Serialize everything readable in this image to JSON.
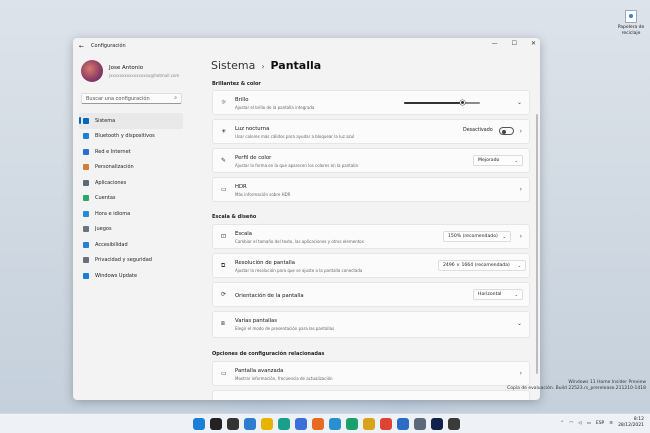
{
  "desktop": {
    "icon_label": "Papelera de reciclaje"
  },
  "window": {
    "title": "Configuración",
    "back_glyph": "←",
    "btn_min": "—",
    "btn_max": "☐",
    "btn_close": "✕"
  },
  "user": {
    "name": "Jose Antonio",
    "email": "jxxxxxxxxxxxxxxxxx@hotmail.com"
  },
  "search": {
    "placeholder": "Buscar una configuración",
    "icon": "search-icon"
  },
  "sidebar": {
    "items": [
      {
        "label": "Sistema",
        "color": "#0067c0",
        "icon": "system-icon",
        "active": true
      },
      {
        "label": "Bluetooth y dispositivos",
        "color": "#1a7fd6",
        "icon": "bluetooth-icon"
      },
      {
        "label": "Red e Internet",
        "color": "#2d6fd1",
        "icon": "network-icon"
      },
      {
        "label": "Personalización",
        "color": "#d27d3b",
        "icon": "brush-icon"
      },
      {
        "label": "Aplicaciones",
        "color": "#5c6b7a",
        "icon": "apps-icon"
      },
      {
        "label": "Cuentas",
        "color": "#2fa566",
        "icon": "account-icon"
      },
      {
        "label": "Hora e idioma",
        "color": "#2b8ad6",
        "icon": "globe-icon"
      },
      {
        "label": "Juegos",
        "color": "#6b7480",
        "icon": "gamepad-icon"
      },
      {
        "label": "Accesibilidad",
        "color": "#2d7dd2",
        "icon": "accessibility-icon"
      },
      {
        "label": "Privacidad y seguridad",
        "color": "#6b6f78",
        "icon": "shield-icon"
      },
      {
        "label": "Windows Update",
        "color": "#1a7fd6",
        "icon": "update-icon"
      }
    ]
  },
  "breadcrumb": {
    "parent": "Sistema",
    "sep": "›",
    "current": "Pantalla"
  },
  "sections": {
    "brightness_color": "Brillantez & color",
    "scale_layout": "Escala & diseño",
    "related": "Opciones de configuración relacionadas"
  },
  "settings": {
    "brillo": {
      "title": "Brillo",
      "subtitle": "Ajustar el brillo de la pantalla integrada",
      "value": 0.77
    },
    "luz": {
      "title": "Luz nocturna",
      "subtitle": "Usar colores más cálidos para ayudar a bloquear la luz azul",
      "state": "Desactivado"
    },
    "perfil": {
      "title": "Perfil de color",
      "subtitle": "Ajustar la forma en la que aparecen los colores en la pantalla",
      "value": "Mejorado"
    },
    "hdr": {
      "title": "HDR",
      "subtitle": "Más información sobre HDR"
    },
    "escala": {
      "title": "Escala",
      "subtitle": "Cambiar el tamaño del texto, las aplicaciones y otros elementos",
      "value": "150% (recomendado)"
    },
    "resolucion": {
      "title": "Resolución de pantalla",
      "subtitle": "Ajustar la resolución para que se ajuste a la pantalla conectada",
      "value": "2496 × 1664 (recomendada)"
    },
    "orientacion": {
      "title": "Orientación de la pantalla",
      "value": "Horizontal"
    },
    "varias": {
      "title": "Varias pantallas",
      "subtitle": "Elegir el modo de presentación para las pantallas"
    },
    "avanzada": {
      "title": "Pantalla avanzada",
      "subtitle": "Mostrar información, frecuencia de actualización"
    }
  },
  "watermark": {
    "line1": "Windows 11 Home Insider Preview",
    "line2": "Copia de evaluación. Build 22523.rs_prerelease.211210-1418"
  },
  "taskbar": {
    "icons": [
      {
        "name": "start-icon",
        "color": "#1a7fd6"
      },
      {
        "name": "search-taskbar-icon",
        "color": "#222222"
      },
      {
        "name": "taskview-icon",
        "color": "#333333"
      },
      {
        "name": "widgets-icon",
        "color": "#2d7dd2"
      },
      {
        "name": "explorer-icon",
        "color": "#e8b400"
      },
      {
        "name": "edge-icon",
        "color": "#1a9f8a"
      },
      {
        "name": "store-icon",
        "color": "#3a6fd8"
      },
      {
        "name": "firefox-icon",
        "color": "#e66a22"
      },
      {
        "name": "edge-beta-icon",
        "color": "#2a8fd0"
      },
      {
        "name": "edge-dev-icon",
        "color": "#1b9e6e"
      },
      {
        "name": "edge-canary-icon",
        "color": "#d9a21a"
      },
      {
        "name": "chrome-icon",
        "color": "#dd4433"
      },
      {
        "name": "app-icon",
        "color": "#2b6cc4"
      },
      {
        "name": "settings-taskbar-icon",
        "color": "#5a6a7a"
      },
      {
        "name": "photoshop-icon",
        "color": "#11224a"
      },
      {
        "name": "terminal-icon",
        "color": "#3a3a3a"
      }
    ],
    "lang": "ESP",
    "time": "8:12",
    "date": "28/12/2021"
  }
}
